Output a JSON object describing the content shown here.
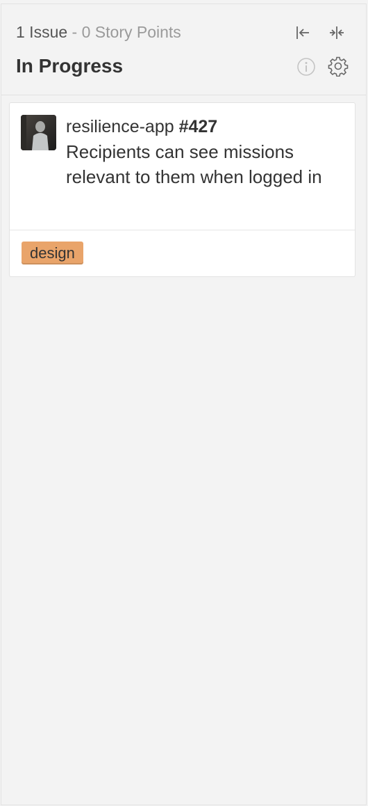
{
  "column": {
    "issue_count": "1 Issue",
    "separator": "-",
    "story_points": "0 Story Points",
    "title": "In Progress",
    "icons": {
      "collapse_left": "collapse-left-icon",
      "collapse_both": "collapse-both-icon",
      "info": "info-icon",
      "settings": "gear-icon"
    }
  },
  "card": {
    "repo": "resilience-app",
    "issue_number": "#427",
    "title": "Recipients can see missions relevant to them when logged in",
    "labels": [
      {
        "name": "design",
        "color": "#e9a46a"
      }
    ]
  },
  "colors": {
    "background": "#f3f3f3",
    "card": "#ffffff",
    "text": "#333333",
    "muted": "#9a9a9a"
  }
}
